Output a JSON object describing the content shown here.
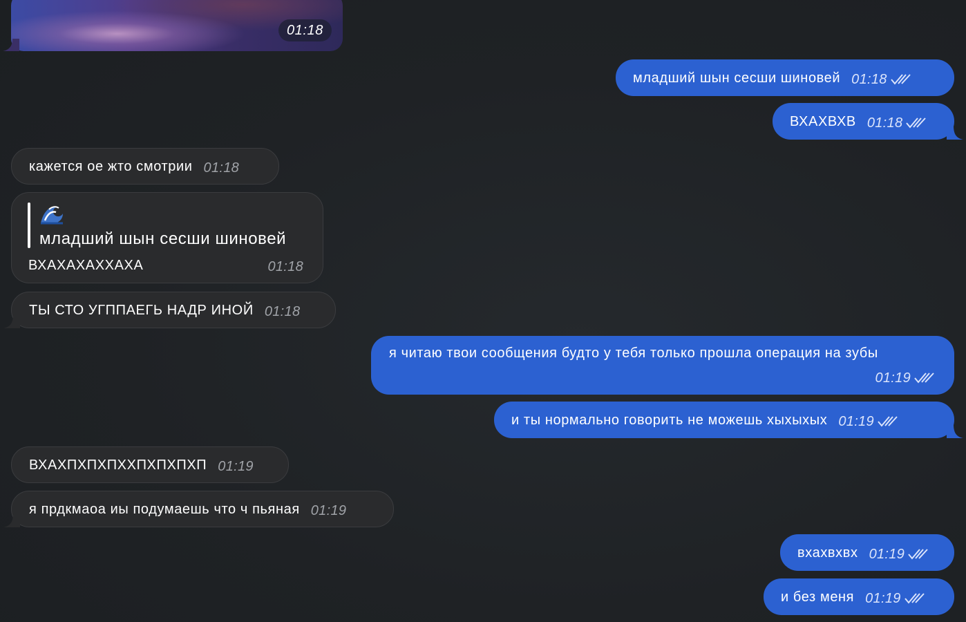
{
  "chat": {
    "media_message": {
      "time": "01:18"
    },
    "messages": [
      {
        "id": "m1",
        "direction": "outgoing",
        "text": "младший шын сесши шиновей",
        "time": "01:18",
        "read": true
      },
      {
        "id": "m2",
        "direction": "outgoing",
        "text": "ВХАХВХВ",
        "time": "01:18",
        "read": true
      },
      {
        "id": "m3",
        "direction": "incoming",
        "text": "кажется ое жто смотрии",
        "time": "01:18"
      },
      {
        "id": "m4",
        "direction": "incoming",
        "reply_to": {
          "icon": "wave-emoji-icon",
          "text": "младший шын сесши шиновей"
        },
        "text": "ВХАХАХАХХАХА",
        "time": "01:18"
      },
      {
        "id": "m5",
        "direction": "incoming",
        "text": "ТЫ СТО УГППАЕГЬ НАДР ИНОЙ",
        "time": "01:18"
      },
      {
        "id": "m6",
        "direction": "outgoing",
        "text": "я читаю твои сообщения будто у тебя только прошла операция на зубы",
        "time": "01:19",
        "read": true
      },
      {
        "id": "m7",
        "direction": "outgoing",
        "text": "и ты нормально говорить не можешь хыхыхых",
        "time": "01:19",
        "read": true
      },
      {
        "id": "m8",
        "direction": "incoming",
        "text": "ВХАХПХПХПХХПХПХПХП",
        "time": "01:19"
      },
      {
        "id": "m9",
        "direction": "incoming",
        "text": "я прдкмаоа иы подумаешь что ч пьяная",
        "time": "01:19"
      },
      {
        "id": "m10",
        "direction": "outgoing",
        "text": "вхахвхвх",
        "time": "01:19",
        "read": true
      },
      {
        "id": "m11",
        "direction": "outgoing",
        "text": "и без меня",
        "time": "01:19",
        "read": true
      }
    ]
  },
  "colors": {
    "background": "#1e2124",
    "incoming_bubble": "#2a2b2d",
    "outgoing_bubble": "#2c61d1",
    "timestamp_incoming": "#a0a3a8",
    "timestamp_outgoing": "#dbe4fb"
  }
}
